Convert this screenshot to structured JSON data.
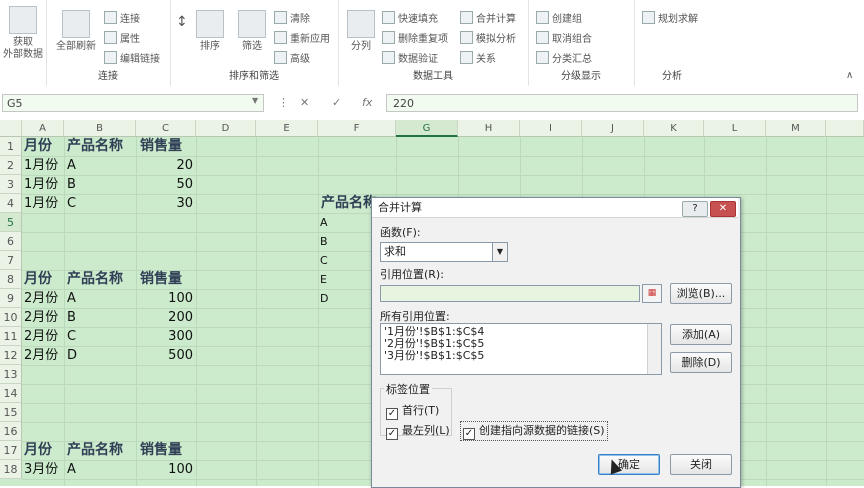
{
  "ribbon": {
    "get_external": [
      "获取",
      "外部数据"
    ],
    "refresh_all": "全部刷新",
    "conn": {
      "connect": "连接",
      "properties": "属性",
      "edit_links": "编辑链接",
      "group": "连接"
    },
    "sort": {
      "sort": "排序",
      "filter": "筛选",
      "clear": "清除",
      "reapply": "重新应用",
      "advanced": "高级",
      "group": "排序和筛选"
    },
    "tools": {
      "split": "分列",
      "flash_fill": "快速填充",
      "remove_dup": "删除重复项",
      "validate": "数据验证",
      "consolidate": "合并计算",
      "whatif": "模拟分析",
      "relations": "关系",
      "group": "数据工具"
    },
    "outline": {
      "group_btn": "创建组",
      "ungroup": "取消组合",
      "subtotal": "分类汇总",
      "group": "分级显示"
    },
    "analysis": {
      "solver": "规划求解",
      "group": "分析"
    }
  },
  "formula_bar": {
    "name_box": "G5",
    "cancel": "✕",
    "enter": "✓",
    "fx": "fx",
    "content": "220"
  },
  "columns": [
    "A",
    "B",
    "C",
    "D",
    "E",
    "F",
    "G",
    "H",
    "I",
    "J",
    "K",
    "L",
    "M"
  ],
  "rows": [
    "1",
    "2",
    "3",
    "4",
    "5",
    "6",
    "7",
    "8",
    "9",
    "10",
    "11",
    "12",
    "13",
    "14",
    "15",
    "16",
    "17",
    "18"
  ],
  "sheet": {
    "h1": [
      "月份",
      "产品名称",
      "销售量"
    ],
    "t1": [
      [
        "1月份",
        "A",
        "20"
      ],
      [
        "1月份",
        "B",
        "50"
      ],
      [
        "1月份",
        "C",
        "30"
      ]
    ],
    "h2": [
      "月份",
      "产品名称",
      "销售量"
    ],
    "t2": [
      [
        "2月份",
        "A",
        "100"
      ],
      [
        "2月份",
        "B",
        "200"
      ],
      [
        "2月份",
        "C",
        "300"
      ],
      [
        "2月份",
        "D",
        "500"
      ]
    ],
    "h3": [
      "月份",
      "产品名称",
      "销售量"
    ],
    "t3": [
      [
        "3月份",
        "A",
        "100"
      ]
    ],
    "f_header": "产品名称",
    "f_items": [
      "A",
      "B",
      "C",
      "E",
      "D"
    ]
  },
  "dialog": {
    "title": "合并计算",
    "help": "?",
    "close": "✕",
    "func_label": "函数(F):",
    "func_value": "求和",
    "ref_label": "引用位置(R):",
    "browse": "浏览(B)...",
    "all_refs_label": "所有引用位置:",
    "refs": [
      "'1月份'!$B$1:$C$4",
      "'2月份'!$B$1:$C$5",
      "'3月份'!$B$1:$C$5"
    ],
    "add": "添加(A)",
    "delete": "删除(D)",
    "label_pos": "标签位置",
    "first_row": "首行(T)",
    "left_col": "最左列(L)",
    "link_source": "创建指向源数据的链接(S)",
    "ok": "确定",
    "close_btn": "关闭"
  }
}
